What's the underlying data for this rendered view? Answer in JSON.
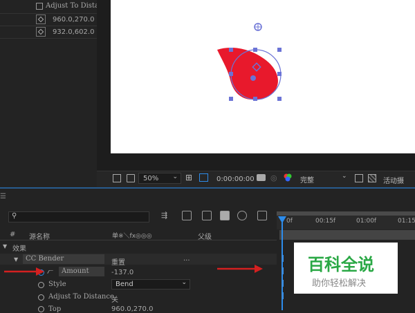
{
  "top_left": {
    "adjust_to_distance_label": "Adjust To Distan",
    "value_1": "960.0,270.0",
    "value_2": "932.0,602.0"
  },
  "viewer_toolbar": {
    "zoom": "50%",
    "timecode": "0:00:00:00",
    "resolution": "完整",
    "camera": "活动摄"
  },
  "timeline": {
    "search_placeholder": "",
    "columns": {
      "hash": "#",
      "source_name": "源名称",
      "switches": "单※＼fx◎◎◎",
      "parent": "父级"
    },
    "ruler": [
      "0f",
      "00:15f",
      "01:00f",
      "01:15"
    ],
    "effects_label": "效果",
    "effect_name": "CC Bender",
    "reset_label": "重置",
    "reset_dots": "...",
    "properties": [
      {
        "name": "Amount",
        "value": "-137.0"
      },
      {
        "name": "Style",
        "value": "Bend"
      },
      {
        "name": "Adjust To Distance",
        "value": "关"
      },
      {
        "name": "Top",
        "value": "960.0,270.0"
      }
    ]
  },
  "watermark": {
    "title": "百科全说",
    "subtitle": "助你轻松解决"
  },
  "colors": {
    "panel_bg": "#232323",
    "accent_blue": "#2d8ceb",
    "shape_red": "#e8192c",
    "arrow_red": "#d42020"
  }
}
